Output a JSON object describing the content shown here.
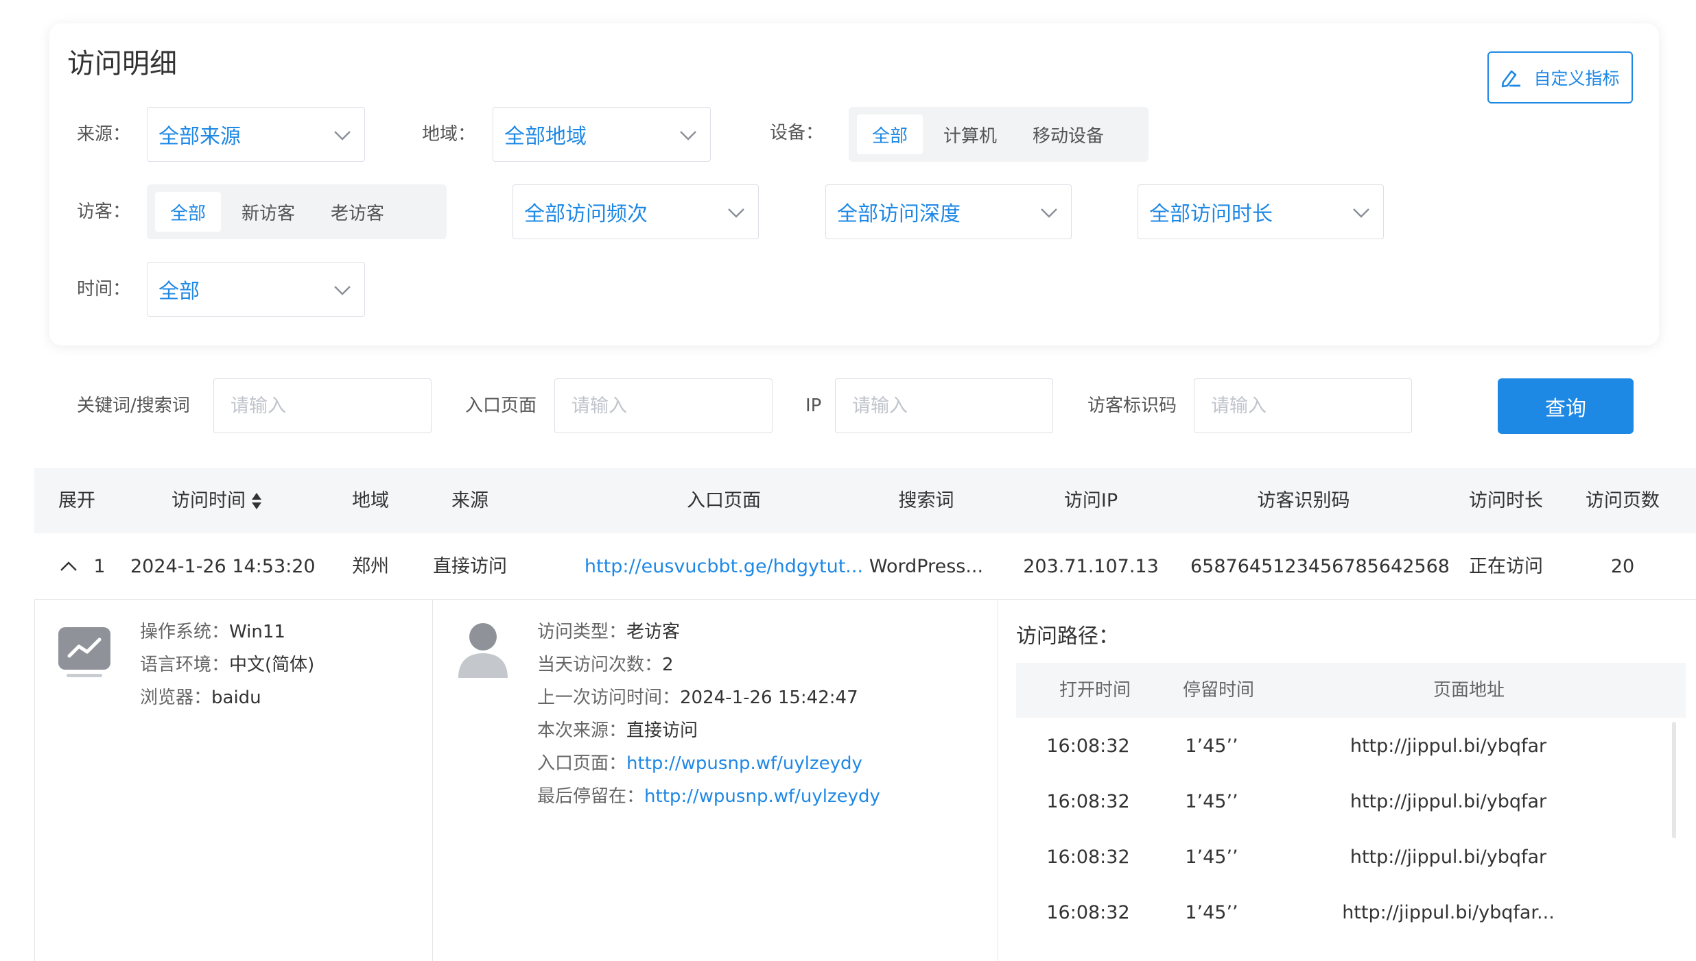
{
  "page": {
    "title": "访问明细",
    "custom_metrics_label": "自定义指标"
  },
  "filters": {
    "source_label": "来源：",
    "source_value": "全部来源",
    "region_label": "地域：",
    "region_value": "全部地域",
    "device_label": "设备：",
    "device_options": [
      "全部",
      "计算机",
      "移动设备"
    ],
    "device_selected": "全部",
    "visitor_label": "访客：",
    "visitor_options": [
      "全部",
      "新访客",
      "老访客"
    ],
    "visitor_selected": "全部",
    "frequency_value": "全部访问频次",
    "depth_value": "全部访问深度",
    "duration_value": "全部访问时长",
    "time_label": "时间：",
    "time_value": "全部"
  },
  "search": {
    "keyword_label": "关键词/搜索词",
    "keyword_placeholder": "请输入",
    "entry_label": "入口页面",
    "entry_placeholder": "请输入",
    "ip_label": "IP",
    "ip_placeholder": "请输入",
    "visitor_id_label": "访客标识码",
    "visitor_id_placeholder": "请输入",
    "query_label": "查询"
  },
  "table": {
    "headers": [
      "展开",
      "访问时间",
      "地域",
      "来源",
      "入口页面",
      "搜索词",
      "访问IP",
      "访客识别码",
      "访问时长",
      "访问页数"
    ],
    "row": {
      "index": "1",
      "time": "2024-1-26 14:53:20",
      "region": "郑州",
      "source": "直接访问",
      "entry": "http://eusvucbbt.ge/hdgytut...",
      "keyword": "WordPress...",
      "ip": "203.71.107.13",
      "visitor_id": "6587645123456785642568",
      "duration": "正在访问",
      "pages": "20"
    }
  },
  "detail": {
    "os_label": "操作系统：",
    "os_value": "Win11",
    "lang_label": "语言环境：",
    "lang_value": "中文(简体)",
    "browser_label": "浏览器：",
    "browser_value": "baidu",
    "visit_type_label": "访问类型：",
    "visit_type_value": "老访客",
    "today_count_label": "当天访问次数：",
    "today_count_value": "2",
    "last_visit_label": "上一次访问时间：",
    "last_visit_value": "2024-1-26 15:42:47",
    "this_source_label": "本次来源：",
    "this_source_value": "直接访问",
    "entry_label": "入口页面：",
    "entry_value": "http://wpusnp.wf/uylzeydy",
    "last_stay_label": "最后停留在：",
    "last_stay_value": "http://wpusnp.wf/uylzeydy",
    "path_title": "访问路径：",
    "path_headers": [
      "打开时间",
      "停留时间",
      "页面地址"
    ],
    "path_rows": [
      {
        "open": "16:08:32",
        "stay": "1’45’’",
        "url": "http://jippul.bi/ybqfar"
      },
      {
        "open": "16:08:32",
        "stay": "1’45’’",
        "url": "http://jippul.bi/ybqfar"
      },
      {
        "open": "16:08:32",
        "stay": "1’45’’",
        "url": "http://jippul.bi/ybqfar"
      },
      {
        "open": "16:08:32",
        "stay": "1’45’’",
        "url": "http://jippul.bi/ybqfar..."
      }
    ]
  },
  "colors": {
    "accent": "#1e88e5",
    "border": "#dcdfe6",
    "header_bg": "#f5f6f7"
  }
}
